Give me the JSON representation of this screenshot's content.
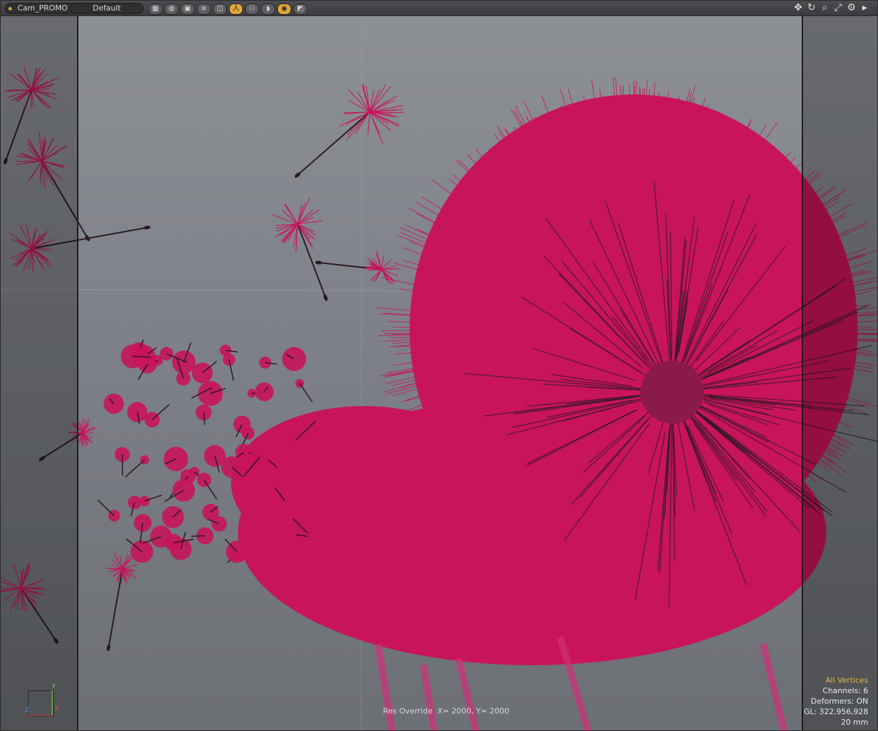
{
  "toolbar": {
    "camera": "Cam_PROMO",
    "style": "Default",
    "buttons": [
      {
        "name": "wireframe-grid-icon",
        "glyph": "▦",
        "active": false
      },
      {
        "name": "smooth-shade-icon",
        "glyph": "◍",
        "active": false
      },
      {
        "name": "solid-shade-icon",
        "glyph": "▣",
        "active": false
      },
      {
        "name": "texture-icon",
        "glyph": "≋",
        "active": false
      },
      {
        "name": "reflection-icon",
        "glyph": "◫",
        "active": false
      },
      {
        "name": "skeleton-icon",
        "glyph": "人",
        "active": true
      },
      {
        "name": "weight-icon",
        "glyph": "⚇",
        "active": false
      },
      {
        "name": "clip-icon",
        "glyph": "◗",
        "active": false
      },
      {
        "name": "advanced-shade-icon",
        "glyph": "◉",
        "active": true
      },
      {
        "name": "render-preview-icon",
        "glyph": "◩",
        "active": false
      }
    ],
    "right_icons": [
      {
        "name": "pan-icon",
        "glyph": "✥"
      },
      {
        "name": "rotate-icon",
        "glyph": "↻"
      },
      {
        "name": "zoom-icon",
        "glyph": "⌕"
      },
      {
        "name": "fit-view-icon",
        "glyph": "⤢"
      },
      {
        "name": "settings-icon",
        "glyph": "⚙"
      },
      {
        "name": "more-arrow-icon",
        "glyph": "▸"
      }
    ]
  },
  "viewport": {
    "res_override": "Res Override  X= 2000, Y= 2000",
    "stats": {
      "selection_mode": "All Vertices",
      "channels": "Channels: 6",
      "deformers": "Deformers: ON",
      "gl": "GL: 322,956,928",
      "scale": "20 mm"
    },
    "axis": {
      "y": "Y",
      "x": "X",
      "z": "Z"
    }
  },
  "colors": {
    "mesh": "#c8145a",
    "stem": "#2a1a22",
    "accent": "#e5a73a"
  }
}
